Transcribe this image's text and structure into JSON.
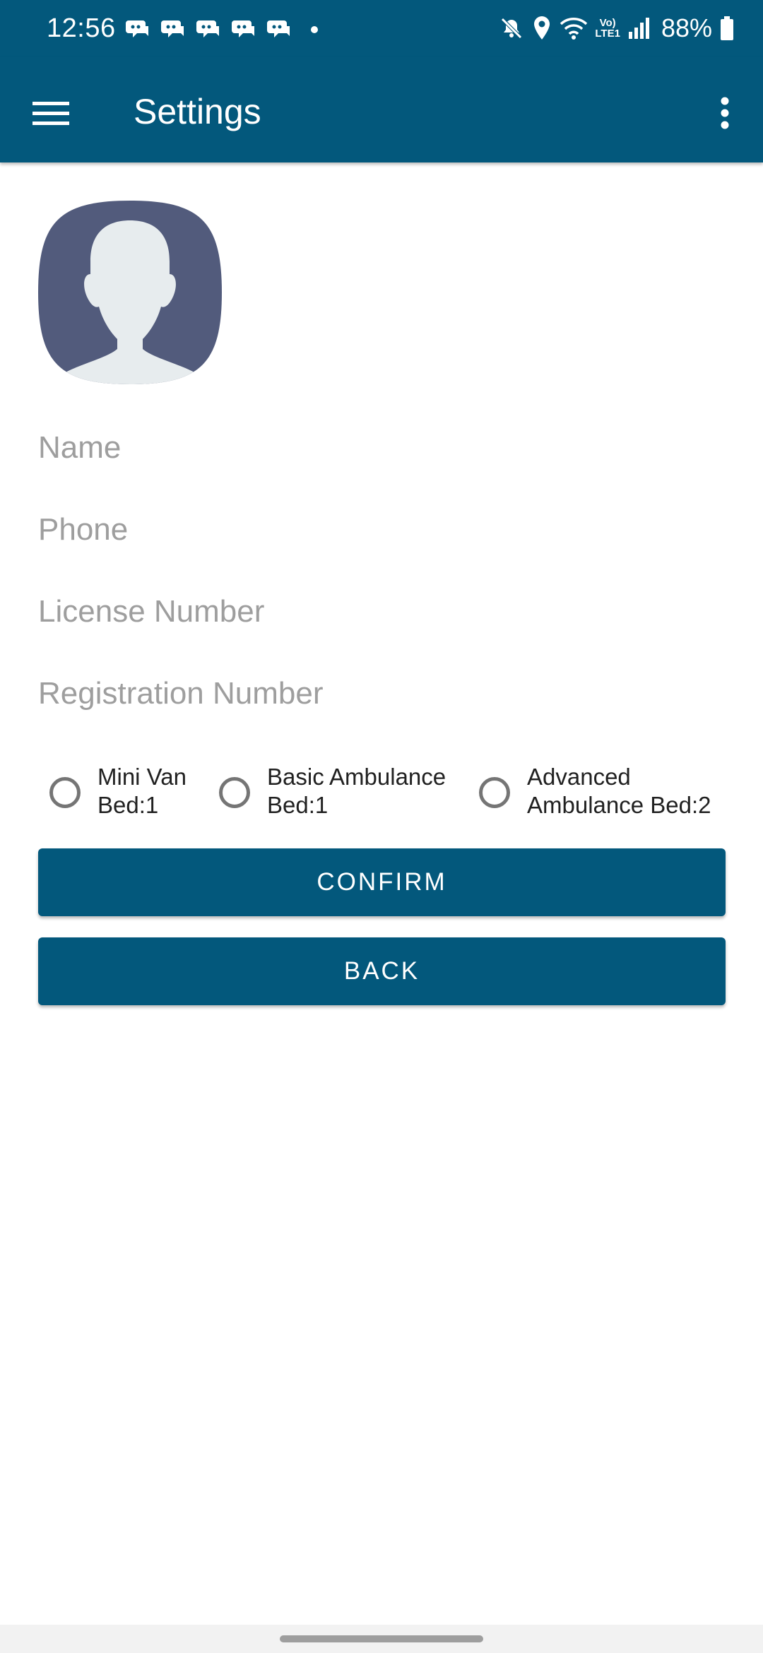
{
  "status_bar": {
    "time": "12:56",
    "notification_icons": [
      "discord-icon",
      "discord-icon",
      "discord-icon",
      "discord-icon",
      "discord-icon"
    ],
    "battery_percent": "88%",
    "network_label_top": "Vo)",
    "network_label_bottom": "LTE1"
  },
  "app_bar": {
    "title": "Settings",
    "background_color": "#03587c"
  },
  "form": {
    "name_placeholder": "Name",
    "phone_placeholder": "Phone",
    "license_placeholder": "License Number",
    "registration_placeholder": "Registration Number"
  },
  "vehicle_options": [
    {
      "line1": "Mini Van",
      "line2": "Bed:1",
      "selected": false
    },
    {
      "line1": "Basic Ambulance",
      "line2": "Bed:1",
      "selected": false
    },
    {
      "line1": "Advanced",
      "line2": "Ambulance Bed:2",
      "selected": false
    }
  ],
  "buttons": {
    "confirm_label": "CONFIRM",
    "back_label": "BACK"
  },
  "colors": {
    "primary": "#03587c",
    "hint_text": "#9e9e9e",
    "avatar_bg": "#525b7c",
    "avatar_fg": "#e7ecee"
  }
}
